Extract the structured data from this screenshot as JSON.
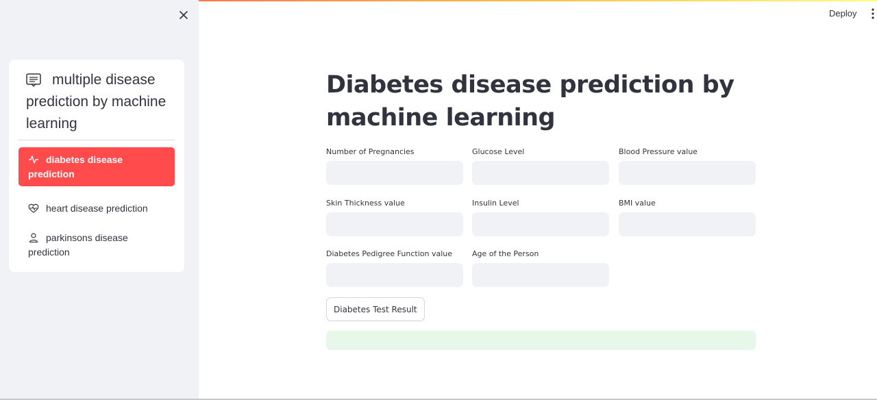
{
  "sidebar": {
    "menu_title": "multiple disease prediction by machine learning",
    "items": [
      {
        "label": "diabetes disease prediction",
        "icon": "activity-icon",
        "active": true
      },
      {
        "label": "heart disease prediction",
        "icon": "heart-pulse-icon",
        "active": false
      },
      {
        "label": "parkinsons disease prediction",
        "icon": "person-icon",
        "active": false
      }
    ]
  },
  "header": {
    "deploy_label": "Deploy"
  },
  "main": {
    "title": "Diabetes disease prediction by machine learning",
    "fields": [
      {
        "label": "Number of Pregnancies",
        "value": ""
      },
      {
        "label": "Glucose Level",
        "value": ""
      },
      {
        "label": "Blood Pressure value",
        "value": ""
      },
      {
        "label": "Skin Thickness value",
        "value": ""
      },
      {
        "label": "Insulin Level",
        "value": ""
      },
      {
        "label": "BMI value",
        "value": ""
      },
      {
        "label": "Diabetes Pedigree Function value",
        "value": ""
      },
      {
        "label": "Age of the Person",
        "value": ""
      }
    ],
    "button_label": "Diabetes Test Result",
    "result_text": ""
  },
  "colors": {
    "accent": "#ff4b4b",
    "sidebar_bg": "#f0f2f6",
    "input_bg": "#f0f2f6",
    "success_bg": "#e7f8ea",
    "text": "#31333f"
  }
}
